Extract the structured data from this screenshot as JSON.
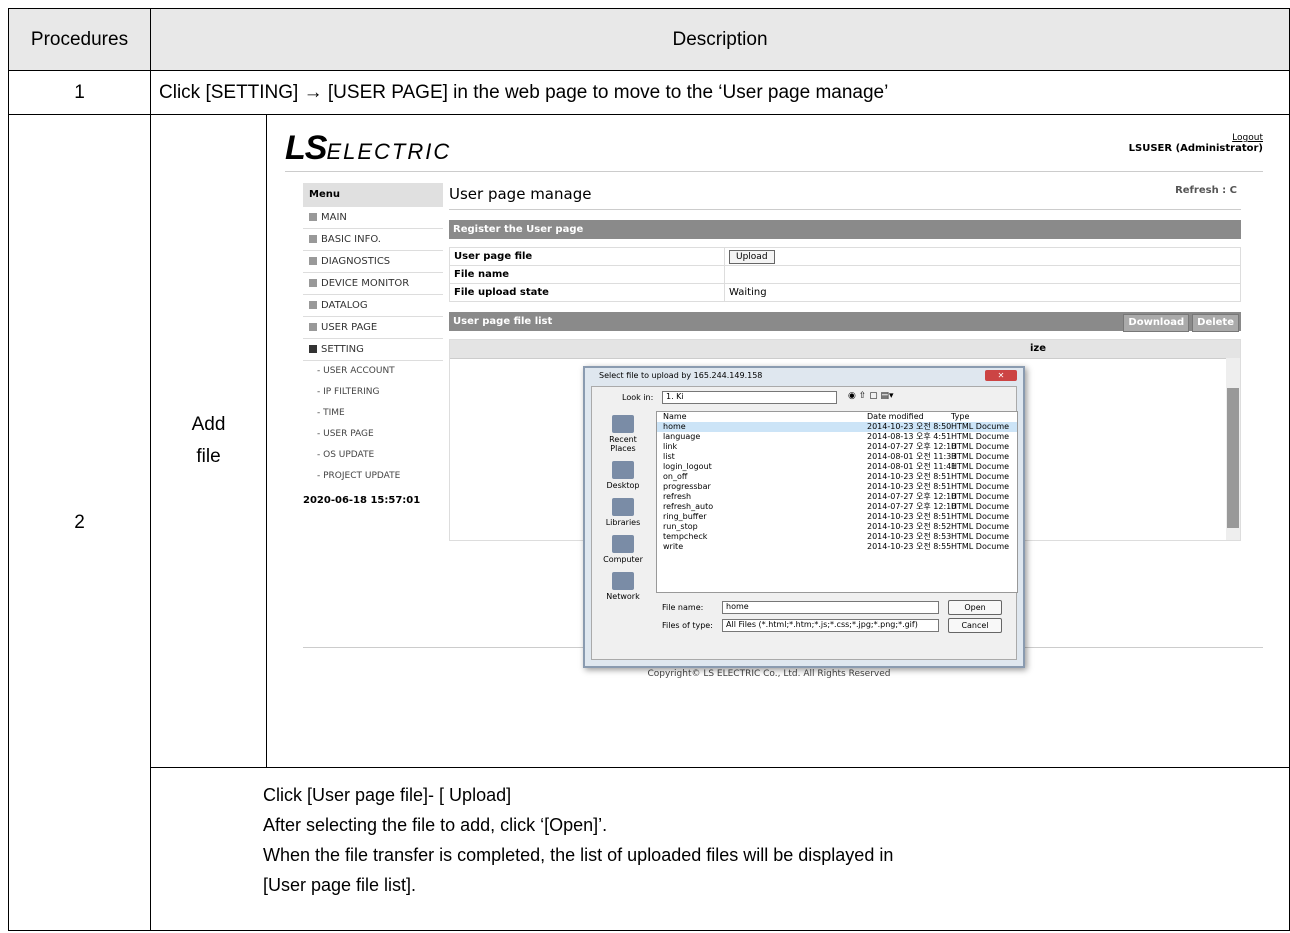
{
  "table": {
    "col_header_1": "Procedures",
    "col_header_2": "Description",
    "row1_num": "1",
    "row1_text": "Click [SETTING] → [USER PAGE] in the web page to move to the ‘User page manage’",
    "row2_num": "2",
    "row2_label_line1": "Add",
    "row2_label_line2": "file",
    "desc_lines": [
      "Click [User page file]- [ Upload]",
      "After selecting the file to add, click ‘[Open]’.",
      "When the file transfer is completed, the list of uploaded files will be displayed in",
      "[User page file list]."
    ]
  },
  "screenshot": {
    "logo_ls": "LS",
    "logo_electric": "ELECTRIC",
    "logout": "Logout",
    "user": "LSUSER (Administrator)",
    "menu_title": "Menu",
    "menu_items": [
      "MAIN",
      "BASIC INFO.",
      "DIAGNOSTICS",
      "DEVICE MONITOR",
      "DATALOG",
      "USER PAGE",
      "SETTING"
    ],
    "submenu_items": [
      "- USER ACCOUNT",
      "- IP FILTERING",
      "- TIME",
      "- USER PAGE",
      "- OS UPDATE",
      "- PROJECT UPDATE"
    ],
    "datetime": "2020-06-18 15:57:01",
    "page_title": "User page manage",
    "refresh": "Refresh : C",
    "register_bar": "Register the User page",
    "user_page_file": "User page file",
    "upload_btn": "Upload",
    "file_name": "File name",
    "file_upload_state": "File upload state",
    "upload_state_value": "Waiting",
    "file_list_bar": "User page file list",
    "download_btn": "Download",
    "delete_btn": "Delete",
    "list_col_size": "ize",
    "copyright": "Copyright© LS ELECTRIC Co., Ltd. All Rights Reserved"
  },
  "dialog": {
    "title": "Select file to upload by 165.244.149.158",
    "look_in_label": "Look in:",
    "look_in_value": "1. Ki",
    "places": [
      "Recent Places",
      "Desktop",
      "Libraries",
      "Computer",
      "Network"
    ],
    "col_name": "Name",
    "col_date": "Date modified",
    "col_type": "Type",
    "files": [
      {
        "name": "home",
        "date": "2014-10-23 오전 8:50",
        "type": "HTML Docume"
      },
      {
        "name": "language",
        "date": "2014-08-13 오후 4:51",
        "type": "HTML Docume"
      },
      {
        "name": "link",
        "date": "2014-07-27 오후 12:10",
        "type": "HTML Docume"
      },
      {
        "name": "list",
        "date": "2014-08-01 오전 11:33",
        "type": "HTML Docume"
      },
      {
        "name": "login_logout",
        "date": "2014-08-01 오전 11:41",
        "type": "HTML Docume"
      },
      {
        "name": "on_off",
        "date": "2014-10-23 오전 8:51",
        "type": "HTML Docume"
      },
      {
        "name": "progressbar",
        "date": "2014-10-23 오전 8:51",
        "type": "HTML Docume"
      },
      {
        "name": "refresh",
        "date": "2014-07-27 오후 12:10",
        "type": "HTML Docume"
      },
      {
        "name": "refresh_auto",
        "date": "2014-07-27 오후 12:10",
        "type": "HTML Docume"
      },
      {
        "name": "ring_buffer",
        "date": "2014-10-23 오전 8:51",
        "type": "HTML Docume"
      },
      {
        "name": "run_stop",
        "date": "2014-10-23 오전 8:52",
        "type": "HTML Docume"
      },
      {
        "name": "tempcheck",
        "date": "2014-10-23 오전 8:53",
        "type": "HTML Docume"
      },
      {
        "name": "write",
        "date": "2014-10-23 오전 8:55",
        "type": "HTML Docume"
      }
    ],
    "file_name_label": "File name:",
    "file_name_value": "home",
    "file_type_label": "Files of type:",
    "file_type_value": "All Files (*.html;*.htm;*.js;*.css;*.jpg;*.png;*.gif)",
    "open_btn": "Open",
    "cancel_btn": "Cancel"
  }
}
